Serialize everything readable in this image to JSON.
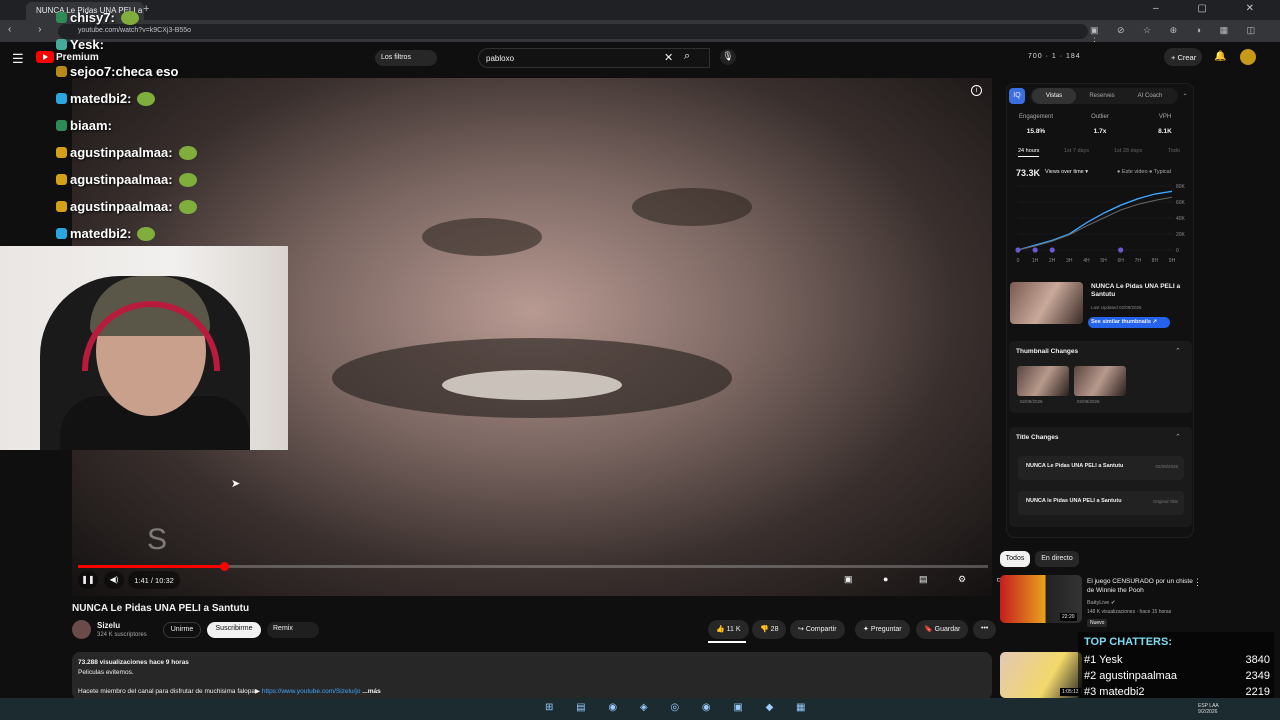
{
  "browser": {
    "tab_title": "NUNCA Le Pidas UNA PELI a Santutu",
    "url": "youtube.com/watch?v=k9CXj3-B55o",
    "new_tab": "+",
    "window_controls": "– ▢ ✕",
    "nav": "‹ › ⟳",
    "ext_icons": "▣ ⊘ ☆ ⊕ ◑ ▦ ◫ ⋮"
  },
  "header": {
    "brand": "Premium",
    "filters_label": "Los filtros",
    "search_value": "pabloxo",
    "clear_icon": "✕",
    "search_icon": "⌕",
    "mic_icon": "🎙",
    "stats": "700 · 1 · 184",
    "create_label": "+ Crear",
    "bell_icon": "🔔"
  },
  "chat": [
    {
      "user": "chisy7:",
      "text": "",
      "badge": "#2e8b57",
      "emote": true
    },
    {
      "user": "Yesk:",
      "text": "",
      "badge": "#4a9",
      "emote": false
    },
    {
      "user": "sejoo7:",
      "text": "checa eso",
      "badge": "#b88a1a",
      "emote": false
    },
    {
      "user": "matedbi2:",
      "text": "",
      "badge": "#2ca6e0",
      "emote": true
    },
    {
      "user": "biaam:",
      "text": "",
      "badge": "#2e8b57",
      "emote": false
    },
    {
      "user": "agustinpaalmaa:",
      "text": "",
      "badge": "#d4a017",
      "emote": true
    },
    {
      "user": "agustinpaalmaa:",
      "text": "",
      "badge": "#d4a017",
      "emote": true
    },
    {
      "user": "agustinpaalmaa:",
      "text": "",
      "badge": "#d4a017",
      "emote": true
    },
    {
      "user": "matedbi2:",
      "text": "",
      "badge": "#2ca6e0",
      "emote": true
    }
  ],
  "player": {
    "time": "1:41 / 10:32",
    "progress": 0.16,
    "play_icon": "❚❚",
    "volume_icon": "◀)",
    "info_icon": "i",
    "watermark": "S",
    "right_controls": "▣ ● ▤ ⚙ ▭ ⤢"
  },
  "video": {
    "title": "NUNCA Le Pidas UNA PELI a Santutu",
    "channel": "Sizelu",
    "subscribers": "324 K suscriptores",
    "join": "Unirme",
    "subscribe": "Suscribirme",
    "remix": "Remix",
    "likes": "11 K",
    "dislikes": "28",
    "share": "Compartir",
    "ask": "Preguntar",
    "save": "Guardar",
    "more": "•••"
  },
  "description": {
    "line1": "73.288 visualizaciones  hace 9 horas",
    "line2": "Peliculas evitemos.",
    "line3": "Hacete miembro del canal para disfrutar de muchisima falopa▶ ",
    "link": "https://www.youtube.com/Sizelu/jo",
    "more": "...más"
  },
  "panel": {
    "tabs": [
      "Vistas",
      "Reserves",
      "AI Coach"
    ],
    "metrics": [
      {
        "label": "Engagement",
        "value": "15.8%"
      },
      {
        "label": "Outlier",
        "value": "1.7x"
      },
      {
        "label": "VPH",
        "value": "8.1K"
      }
    ],
    "ranges": [
      "24 hours",
      "1st 7 days",
      "1st 28 days",
      "Todo"
    ],
    "big_value": "73.3K",
    "views_select": "Views over time ▾",
    "legend": "● Este video  ● Typical",
    "thumb_title": "NUNCA Le Pidas UNA PELI a Santutu",
    "last_updated": "Last Updated 02/09/2026",
    "similar_btn": "See similar thumbnails ↗",
    "thumbnail_changes": "Thumbnail Changes",
    "tc_dates": [
      "02/09/2026",
      "02/09/2026"
    ],
    "title_changes": "Title Changes",
    "titles": [
      {
        "text": "NUNCA Le Pidas UNA PELI a Santutu",
        "tag": "02/09/2026"
      },
      {
        "text": "NUNCA le Pidas UNA PELI a Santutu",
        "tag": "Original Title"
      }
    ]
  },
  "chart_data": {
    "type": "line",
    "x": [
      "0",
      "1H",
      "2H",
      "3H",
      "4H",
      "5H",
      "6H",
      "7H",
      "8H",
      "9H"
    ],
    "y_ticks": [
      "80K",
      "60K",
      "40K",
      "20K",
      "0"
    ],
    "ylim": [
      0,
      80000
    ],
    "series": [
      {
        "name": "Este video",
        "values": [
          0,
          6000,
          12000,
          20000,
          34000,
          46000,
          56000,
          64000,
          70000,
          73300
        ],
        "color": "#3ea6ff"
      },
      {
        "name": "Typical",
        "values": [
          0,
          5000,
          11000,
          19000,
          30000,
          40000,
          50000,
          57000,
          62000,
          66000
        ],
        "color": "#666"
      }
    ]
  },
  "recs": {
    "chip_all": "Todos",
    "chip_live": "En directo",
    "r1": {
      "title": "El juego CENSURADO por un chiste de Winnie the Pooh",
      "channel": "BaityLive ✔",
      "meta": "148 K visualizaciones · hace 15 horas",
      "badge": "Nuevo",
      "duration": "22:20",
      "more": "⋮"
    },
    "r2": {
      "duration": "1:05:13"
    }
  },
  "top_chatters": {
    "title": "TOP CHATTERS:",
    "rows": [
      {
        "rank": "#1 Yesk",
        "count": "3840"
      },
      {
        "rank": "#2 agustinpaalmaa",
        "count": "2349"
      },
      {
        "rank": "#3 matedbi2",
        "count": "2219"
      }
    ]
  },
  "taskbar": {
    "icons": "⊞ ▤ ◉ ◈ ◎ ◉ ▣ ◆ ▦",
    "lang": "ESP LAA",
    "date": "9/2/2026"
  },
  "colors": {
    "accent_red": "#ff0000",
    "link_blue": "#3ea6ff",
    "chatter_title": "#7fdcf4"
  }
}
